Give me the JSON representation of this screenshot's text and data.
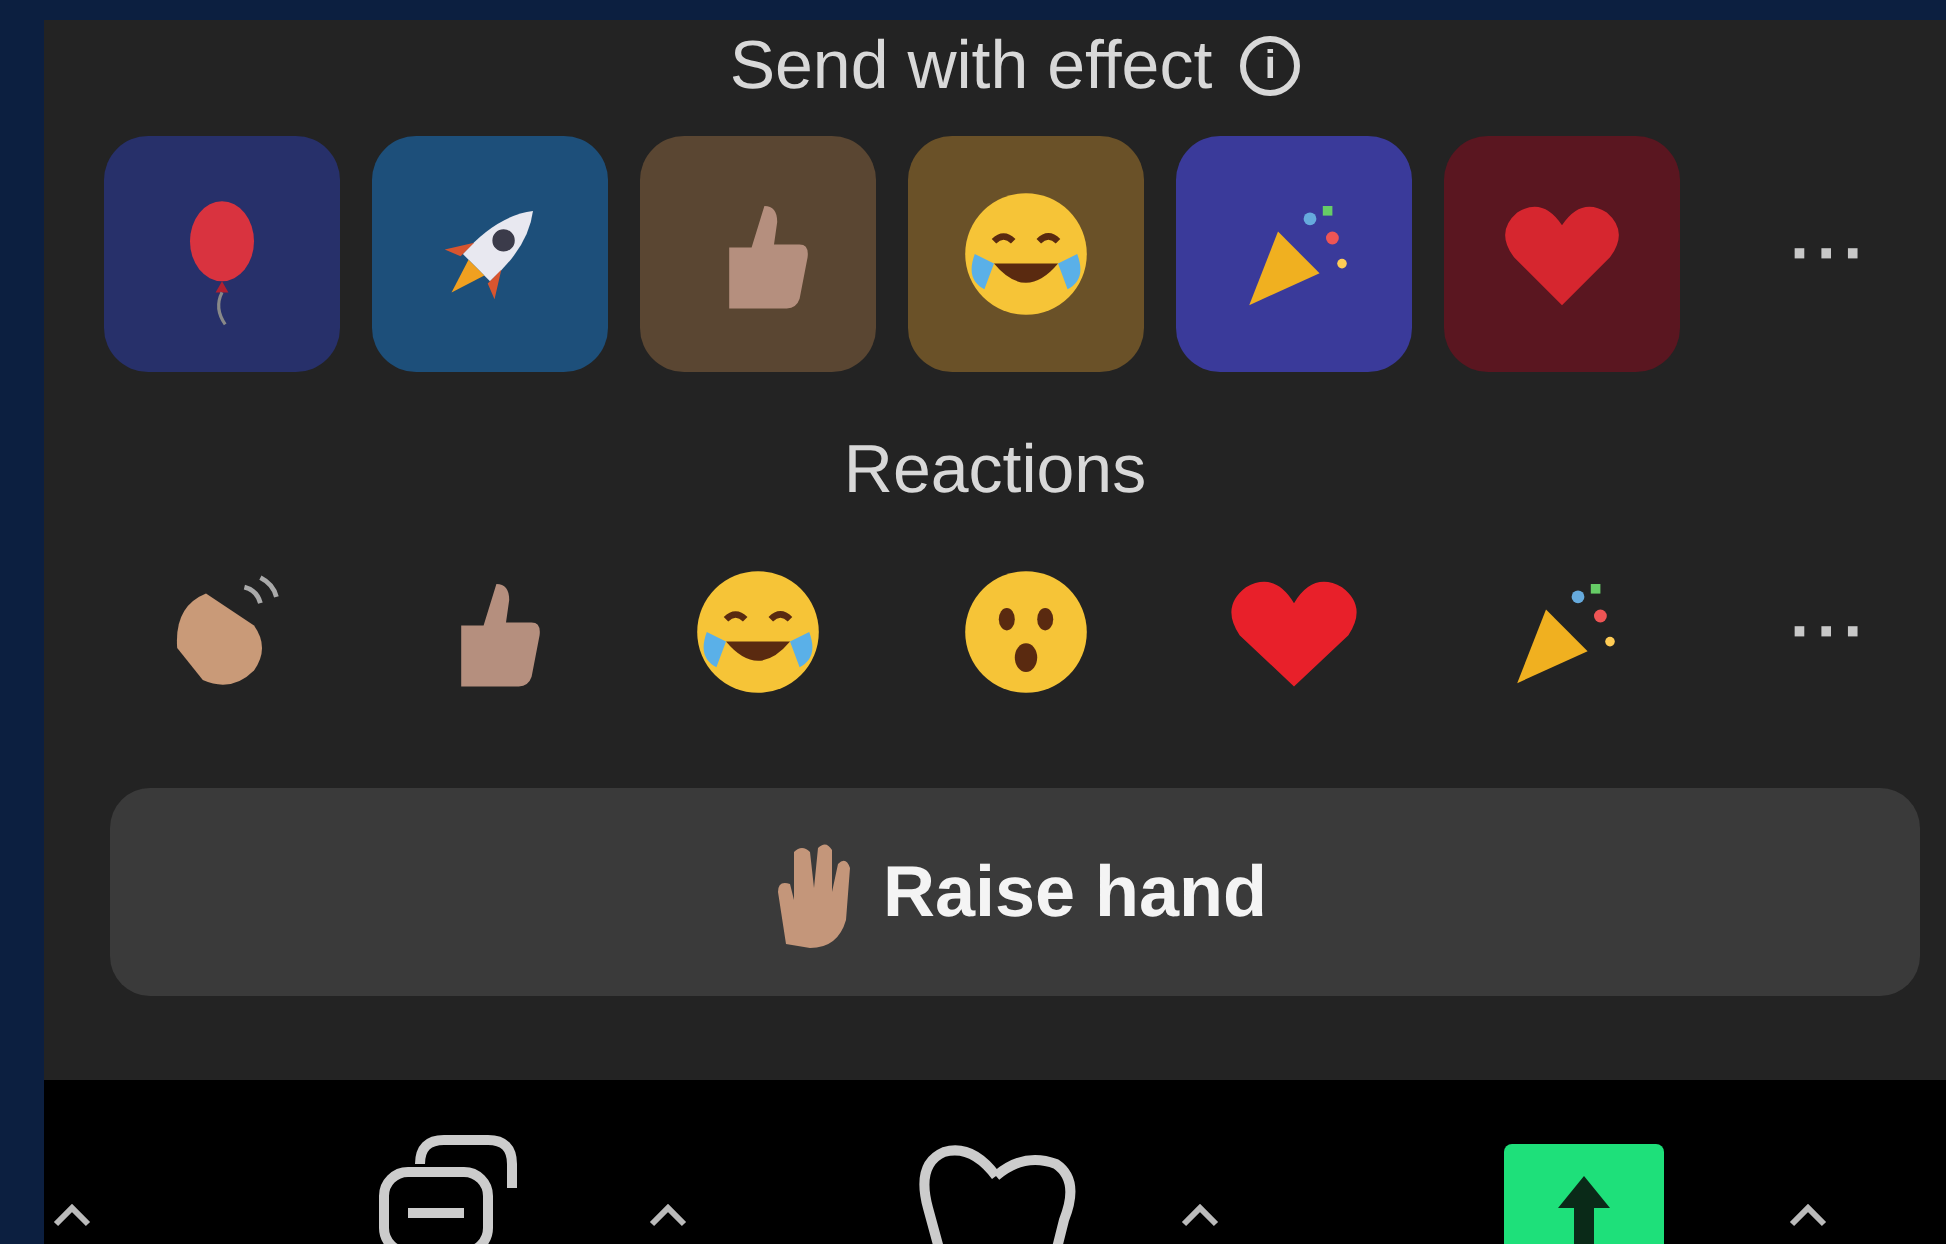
{
  "effects_panel": {
    "title": "Send with effect",
    "info_icon": "i",
    "more": "···"
  },
  "reactions": {
    "title": "Reactions",
    "more": "···"
  },
  "raise_hand_button": {
    "label": "Raise hand"
  },
  "toolbar": {
    "share_selected": true
  }
}
